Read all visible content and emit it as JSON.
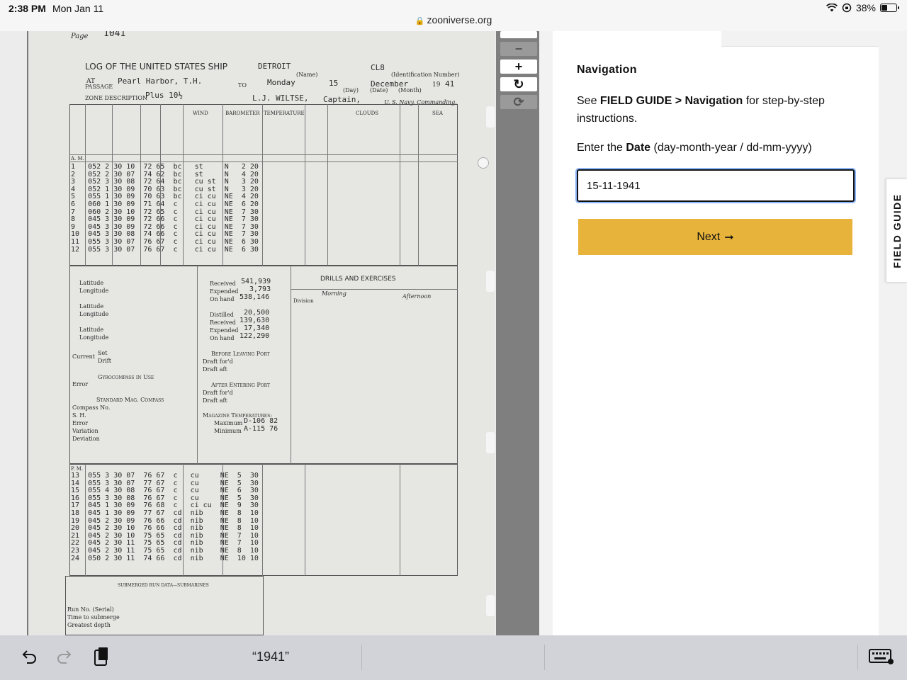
{
  "status_bar": {
    "time": "2:38 PM",
    "date": "Mon Jan 11",
    "battery": "38%",
    "battery_level": 0.38,
    "url": "zooniverse.org"
  },
  "icons": {
    "lock": "lock-icon",
    "wifi": "wifi-icon",
    "orientation": "orientation-lock-icon",
    "battery": "battery-icon",
    "undo": "undo-icon",
    "redo": "redo-icon",
    "clipboard": "clipboard-icon",
    "keyboard": "keyboard-icon",
    "zoom_in": "plus-icon",
    "zoom_out": "minus-icon",
    "reset": "reset-icon",
    "rotate": "rotate-icon"
  },
  "viewer_controls": {
    "zoom_in": "+",
    "zoom_out": "−",
    "reset": "↻",
    "rotate": "⟳"
  },
  "document": {
    "page_label": "Page",
    "page_number": "1041",
    "title": "LOG OF THE UNITED STATES SHIP",
    "ship_name": "DETROIT",
    "ship_number": "CL8",
    "name_label": "(Name)",
    "id_label": "(Identification Number)",
    "at_label": "AT",
    "passage_label": "PASSAGE",
    "place": "Pearl Harbor, T.H.",
    "to_label": "TO",
    "day_of_week": "Monday",
    "day": "15",
    "month": "December",
    "year_prefix": "19",
    "year_suffix": "41",
    "day_label": "(Day)",
    "date_label": "(Date)",
    "month_label": "(Month)",
    "zone_label": "ZONE DESCRIPTION",
    "zone_value": "Plus 10½",
    "captain": "L.J. WILTSE,",
    "captain_title": "Captain,",
    "captain_sub": "U. S. Navy, Commanding.",
    "col_wind": "WIND",
    "col_barometer": "BAROMETER",
    "col_temperature": "TEMPERATURE",
    "col_clouds": "CLOUDS",
    "col_sea": "SEA",
    "am_label": "A. M.",
    "pm_label": "P. M.",
    "am_rows": "1   052 2 30 10  72 65  bc   st     N   2 20\n2   052 2 30 07  74 62  bc   st     N   4 20\n3   052 3 30 08  72 64  bc   cu st  N   3 20\n4   052 1 30 09  70 63  bc   cu st  N   3 20\n5   055 1 30 09  70 63  bc   ci cu  NE  4 20\n6   060 1 30 09  71 64  c    ci cu  NE  6 20\n7   060 2 30 10  72 65  c    ci cu  NE  7 30\n8   045 3 30 09  72 66  c    ci cu  NE  7 30\n9   045 3 30 09  72 66  c    ci cu  NE  7 30\n10  045 3 30 08  74 66  c    ci cu  NE  7 30\n11  055 3 30 07  76 67  c    ci cu  NE  6 30\n12  055 3 30 07  76 67  c    ci cu  NE  6 30",
    "pm_rows": "13  055 3 30 07  76 67  c   cu     NE  5  30\n14  055 3 30 07  77 67  c   cu     NE  5  30\n15  055 4 30 08  76 67  c   cu     NE  6  30\n16  055 3 30 08  76 67  c   cu     NE  5  30\n17  045 1 30 09  76 68  c   ci cu  NE  9  30\n18  045 1 30 09  77 67  cd  nib    NE  8  10\n19  045 2 30 09  76 66  cd  nib    NE  8  10\n20  045 2 30 10  76 66  cd  nib    NE  8  10\n21  045 2 30 10  75 65  cd  nib    NE  7  10\n22  045 2 30 11  75 65  cd  nib    NE  7  10\n23  045 2 30 11  75 65  cd  nib    NE  8  10\n24  050 2 30 11  74 66  cd  nib    NE  10 10",
    "fuel_received_label": "Received",
    "fuel_received": "541,939",
    "fuel_expended_label": "Expended",
    "fuel_expended": "3,793",
    "fuel_onhand_label": "On hand",
    "fuel_onhand": "538,146",
    "water_distilled_label": "Distilled",
    "water_distilled": "20,500",
    "water_received_label": "Received",
    "water_received": "139,630",
    "water_expended_label": "Expended",
    "water_expended": "17,340",
    "water_onhand_label": "On hand",
    "water_onhand": "122,290",
    "latitude": "Latitude",
    "longitude": "Longitude",
    "current_label": "Current",
    "set_label": "Set",
    "drift_label": "Drift",
    "gyro_label": "Gyrocompass in Use",
    "error_label": "Error",
    "mag_label": "Standard Mag. Compass",
    "compass_no": "Compass No.",
    "sh_label": "S. H.",
    "variation_label": "Variation",
    "deviation_label": "Deviation",
    "before_port": "Before Leaving Port",
    "after_port": "After Entering Port",
    "draft_fwd": "Draft for'd",
    "draft_aft": "Draft aft",
    "magazine_label": "Magazine Temperatures:",
    "max_label": "Maximum",
    "max_value": "D-106 82",
    "min_label": "Minimum",
    "min_value": "A-115 76",
    "drills_title": "DRILLS AND EXERCISES",
    "morning_label": "Morning",
    "afternoon_label": "Afternoon",
    "division_label": "Division",
    "submerged_title": "SUBMERGED RUN DATA—SUBMARINES",
    "run_no": "Run No. (Serial)",
    "time_submerge": "Time to submerge",
    "greatest_depth": "Greatest depth"
  },
  "task": {
    "heading": "Navigation",
    "desc_see": "See ",
    "desc_link": "FIELD GUIDE > Navigation",
    "desc_rest": " for step-by-step instructions.",
    "question_prefix": "Enter the ",
    "question_bold": "Date",
    "question_suffix": " (day-month-year / dd-mm-yyyy)",
    "date_value": "15-11-1941",
    "next_label": "Next",
    "next_arrow": "➞",
    "field_guide": "FIELD GUIDE"
  },
  "keyboard_bar": {
    "suggestion": "“1941”"
  }
}
